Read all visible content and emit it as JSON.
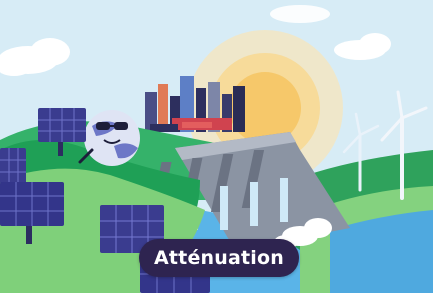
{
  "illustration": {
    "badge_label": "Atténuation",
    "colors": {
      "sky": "#d7ecf6",
      "sun": "#f6cf74",
      "hill_dark": "#1fa056",
      "hill_light": "#7fd07a",
      "water": "#5ab4e8",
      "dam": "#8b94a3",
      "solar_panel": "#3a3c8f",
      "badge_bg": "#2e2450"
    },
    "icons": [
      "planet-mascot-icon",
      "solar-panel-icon",
      "wind-turbine-icon",
      "dam-icon",
      "city-skyline-icon",
      "cloud-icon",
      "sun-icon"
    ]
  }
}
